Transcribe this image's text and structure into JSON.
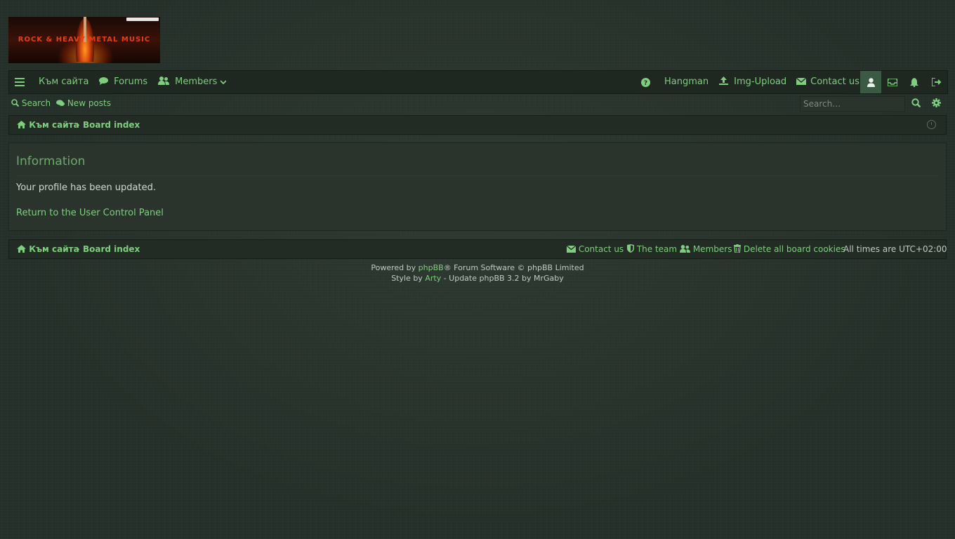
{
  "logo": {
    "text": "ROCK & HEAVY METAL MUSIC"
  },
  "navbar": {
    "menu_icon": "hamburger-icon",
    "site_link": "Към сайта",
    "forums": "Forums",
    "members": "Members",
    "hangman": "Hangman",
    "img_upload": "Img-Upload",
    "contact": "Contact us",
    "right_icons": [
      "help-icon",
      "user-icon",
      "inbox-icon",
      "bell-icon",
      "logout-icon"
    ]
  },
  "subbar": {
    "search": "Search",
    "new_posts": "New posts",
    "search_placeholder": "Search…"
  },
  "breadcrumb": {
    "home": "Към сайта",
    "sep": "›",
    "board": "Board index"
  },
  "info": {
    "title": "Information",
    "message": "Your profile has been updated.",
    "return_link": "Return to the User Control Panel"
  },
  "footer": {
    "contact": "Contact us",
    "team": "The team",
    "members": "Members",
    "delete_cookies": "Delete all board cookies",
    "times_label": "All times are",
    "timezone": "UTC+02:00"
  },
  "copyright": {
    "powered_by": "Powered by",
    "phpbb": "phpBB",
    "forum_software": "® Forum Software © phpBB Limited",
    "style_by": "Style by",
    "arty": "Arty",
    "update": "- Update phpBB 3.2 by MrGaby"
  },
  "colors": {
    "link": "#7fce7f",
    "background": "#26302a",
    "active_tab": "#3a5a44"
  }
}
